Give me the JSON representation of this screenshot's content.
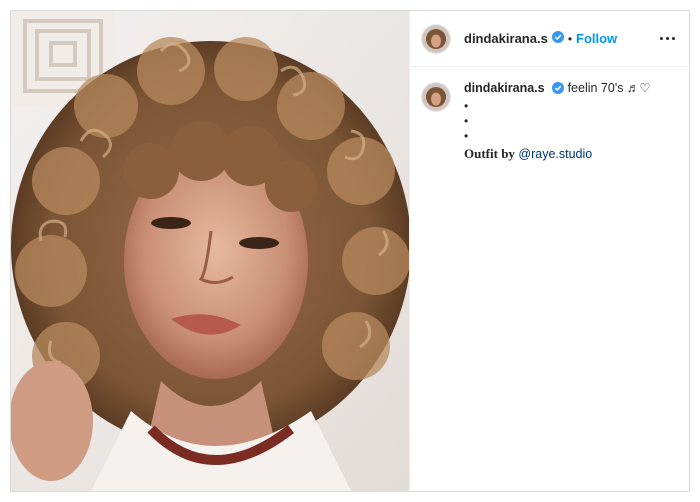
{
  "post": {
    "username": "dindakirana.s",
    "dot_separator": "•",
    "follow_label": "Follow",
    "more_icon": "more-horizontal-icon",
    "verified_icon": "verified-badge-icon",
    "verified_color": "#3897f0",
    "follow_color": "#0095f6"
  },
  "caption": {
    "username": "dindakirana.s",
    "text": "feelin 70's ♬♡",
    "bullet_lines": [
      "•",
      "•",
      "•"
    ],
    "outfit_label": "Outfit by",
    "outfit_mention": "@raye.studio"
  }
}
